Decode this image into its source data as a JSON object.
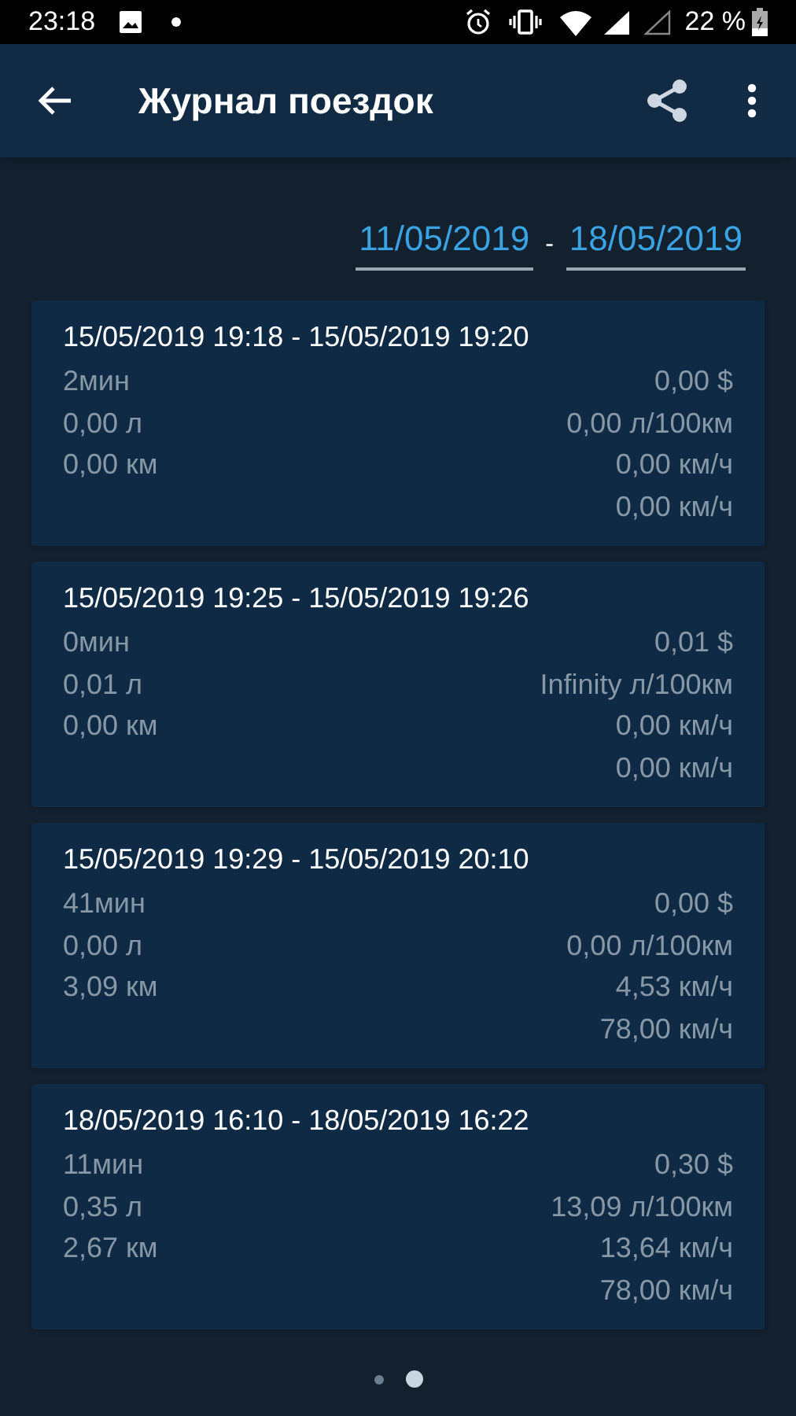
{
  "status_bar": {
    "time": "23:18",
    "battery": "22 %"
  },
  "app_bar": {
    "title": "Журнал поездок"
  },
  "date_range": {
    "from": "11/05/2019",
    "separator": "-",
    "to": "18/05/2019"
  },
  "trips": [
    {
      "period": "15/05/2019 19:18 - 15/05/2019 19:20",
      "duration": "2мин",
      "cost": "0,00 $",
      "fuel": "0,00 л",
      "consumption": "0,00 л/100км",
      "distance": "0,00 км",
      "avg_speed": "0,00 км/ч",
      "max_speed": "0,00 км/ч"
    },
    {
      "period": "15/05/2019 19:25 - 15/05/2019 19:26",
      "duration": "0мин",
      "cost": "0,01 $",
      "fuel": "0,01 л",
      "consumption": "Infinity л/100км",
      "distance": "0,00 км",
      "avg_speed": "0,00 км/ч",
      "max_speed": "0,00 км/ч"
    },
    {
      "period": "15/05/2019 19:29 - 15/05/2019 20:10",
      "duration": "41мин",
      "cost": "0,00 $",
      "fuel": "0,00 л",
      "consumption": "0,00 л/100км",
      "distance": "3,09 км",
      "avg_speed": "4,53 км/ч",
      "max_speed": "78,00 км/ч"
    },
    {
      "period": "18/05/2019 16:10 - 18/05/2019 16:22",
      "duration": "11мин",
      "cost": "0,30 $",
      "fuel": "0,35 л",
      "consumption": "13,09 л/100км",
      "distance": "2,67 км",
      "avg_speed": "13,64 км/ч",
      "max_speed": "78,00 км/ч"
    }
  ],
  "page_indicator": [
    {
      "selected": false
    },
    {
      "selected": true
    }
  ]
}
